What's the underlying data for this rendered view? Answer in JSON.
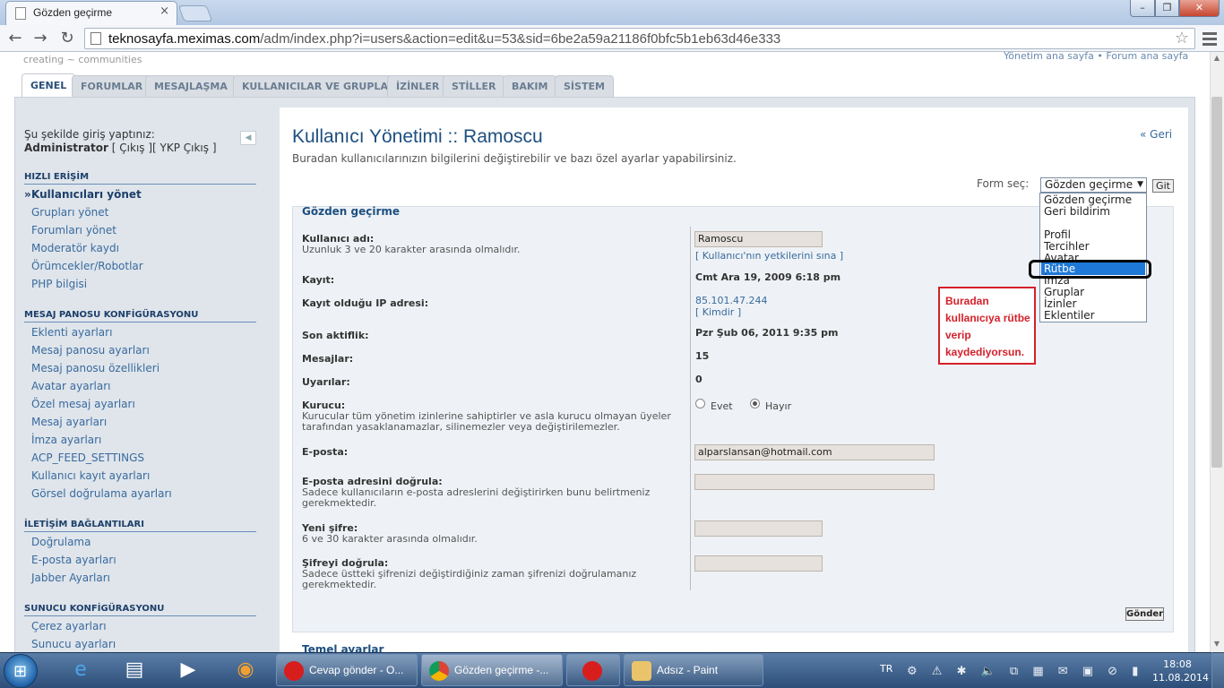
{
  "browser": {
    "tab_title": "Gözden geçirme",
    "tab_close": "×",
    "url_host": "teknosayfa.meximas.com",
    "url_path": "/adm/index.php?i=users&action=edit&u=53&sid=6be2a59a21186f0bfc5b1eb63d46e333",
    "back_icon": "←",
    "forward_icon": "→",
    "reload_icon": "↻",
    "star_icon": "☆",
    "min_icon": "–",
    "max_icon": "❐",
    "close_icon": "✕"
  },
  "site": {
    "logo_text": "creating ~ communities",
    "top_links": "Yönetim ana sayfa • Forum ana sayfa"
  },
  "nav_tabs": [
    "GENEL",
    "FORUMLAR",
    "MESAJLAŞMA",
    "KULLANICILAR VE GRUPLAR",
    "İZİNLER",
    "STİLLER",
    "BAKIM",
    "SİSTEM"
  ],
  "sidebar": {
    "login_line": "Şu şekilde giriş yaptınız:",
    "user": "Administrator",
    "user_links": "[ Çıkış ][ YKP Çıkış ]",
    "collapse_icon": "◀",
    "sections": [
      {
        "title": "HIZLI ERİŞİM",
        "items": [
          "Kullanıcıları yönet",
          "Grupları yönet",
          "Forumları yönet",
          "Moderatör kaydı",
          "Örümcekler/Robotlar",
          "PHP bilgisi"
        ]
      },
      {
        "title": "MESAJ PANOSU KONFİGÜRASYONU",
        "items": [
          "Eklenti ayarları",
          "Mesaj panosu ayarları",
          "Mesaj panosu özellikleri",
          "Avatar ayarları",
          "Özel mesaj ayarları",
          "Mesaj ayarları",
          "İmza ayarları",
          "ACP_FEED_SETTINGS",
          "Kullanıcı kayıt ayarları",
          "Görsel doğrulama ayarları"
        ]
      },
      {
        "title": "İLETİŞİM BAĞLANTILARI",
        "items": [
          "Doğrulama",
          "E-posta ayarları",
          "Jabber Ayarları"
        ]
      },
      {
        "title": "SUNUCU KONFİGÜRASYONU",
        "items": [
          "Çerez ayarları",
          "Sunucu ayarları"
        ]
      }
    ],
    "current_marker": "»"
  },
  "main": {
    "title": "Kullanıcı Yönetimi :: Ramoscu",
    "subtitle": "Buradan kullanıcılarınızın bilgilerini değiştirebilir ve bazı özel ayarlar yapabilirsiniz.",
    "back_link": "« Geri",
    "form_select_label": "Form seç:",
    "form_select_value": "Gözden geçirme",
    "go_button": "Git",
    "dropdown_options": [
      "Gözden geçirme",
      "Geri bildirim",
      "",
      "Profil",
      "Tercihler",
      "Avatar",
      "Rütbe",
      "İmza",
      "Gruplar",
      "İzinler",
      "Eklentiler"
    ],
    "selected_option": "Rütbe",
    "annotation": "Buradan kullanıcıya rütbe verip kaydediyorsun.",
    "legend": "Gözden geçirme",
    "fields": {
      "username_label": "Kullanıcı adı:",
      "username_explain": "Uzunluk 3 ve 20 karakter arasında olmalıdır.",
      "username_value": "Ramoscu",
      "username_link": "[ Kullanıcı'nın yetkilerini sına ]",
      "register_label": "Kayıt:",
      "register_value": "Cmt Ara 19, 2009 6:18 pm",
      "ip_label": "Kayıt olduğu IP adresi:",
      "ip_value": "85.101.47.244",
      "ip_whois": "[ Kimdir ]",
      "last_active_label": "Son aktiflik:",
      "last_active_value": "Pzr Şub 06, 2011 9:35 pm",
      "posts_label": "Mesajlar:",
      "posts_value": "15",
      "warnings_label": "Uyarılar:",
      "warnings_value": "0",
      "founder_label": "Kurucu:",
      "founder_explain": "Kurucular tüm yönetim izinlerine sahiptirler ve asla kurucu olmayan üyeler tarafından yasaklanamazlar, silinemezler veya değiştirilemezler.",
      "founder_yes": "Evet",
      "founder_no": "Hayır",
      "email_label": "E-posta:",
      "email_value": "alparslansan@hotmail.com",
      "email_confirm_label": "E-posta adresini doğrula:",
      "email_confirm_explain": "Sadece kullanıcıların e-posta adreslerini değiştirirken bunu belirtmeniz gerekmektedir.",
      "new_pw_label": "Yeni şifre:",
      "new_pw_explain": "6 ve 30 karakter arasında olmalıdır.",
      "confirm_pw_label": "Şifreyi doğrula:",
      "confirm_pw_explain": "Sadece üstteki şifrenizi değiştirdiğiniz zaman şifrenizi doğrulamanız gerekmektedir."
    },
    "submit": "Gönder",
    "next_legend": "Temel ayarlar"
  },
  "taskbar": {
    "buttons": [
      "Cevap gönder - O...",
      "Gözden geçirme -...",
      "",
      "Adsız - Paint"
    ],
    "lang": "TR",
    "time": "18:08",
    "date": "11.08.2014",
    "tray": "⚙ ⚠ ✱ 🔈 ⧉ ▦ ✉ ▣ ⊘ ▮"
  },
  "colors": {
    "accent": "#1d4f80",
    "link": "#3a6a9e",
    "annotation": "#d4202a",
    "selected": "#1e78d8"
  }
}
